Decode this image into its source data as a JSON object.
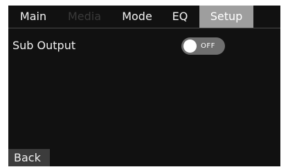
{
  "tabs": {
    "main": "Main",
    "media": "Media",
    "mode": "Mode",
    "eq": "EQ",
    "setup": "Setup",
    "active": "Setup",
    "disabled": [
      "Media"
    ]
  },
  "settings": {
    "sub_output": {
      "label": "Sub Output",
      "state_text": "OFF",
      "enabled": false
    }
  },
  "footer": {
    "back_label": "Back"
  },
  "colors": {
    "background": "#111111",
    "active_tab": "#9e9e9e",
    "toggle_off": "#6f6f6f",
    "back_button": "#3c3c3c"
  }
}
